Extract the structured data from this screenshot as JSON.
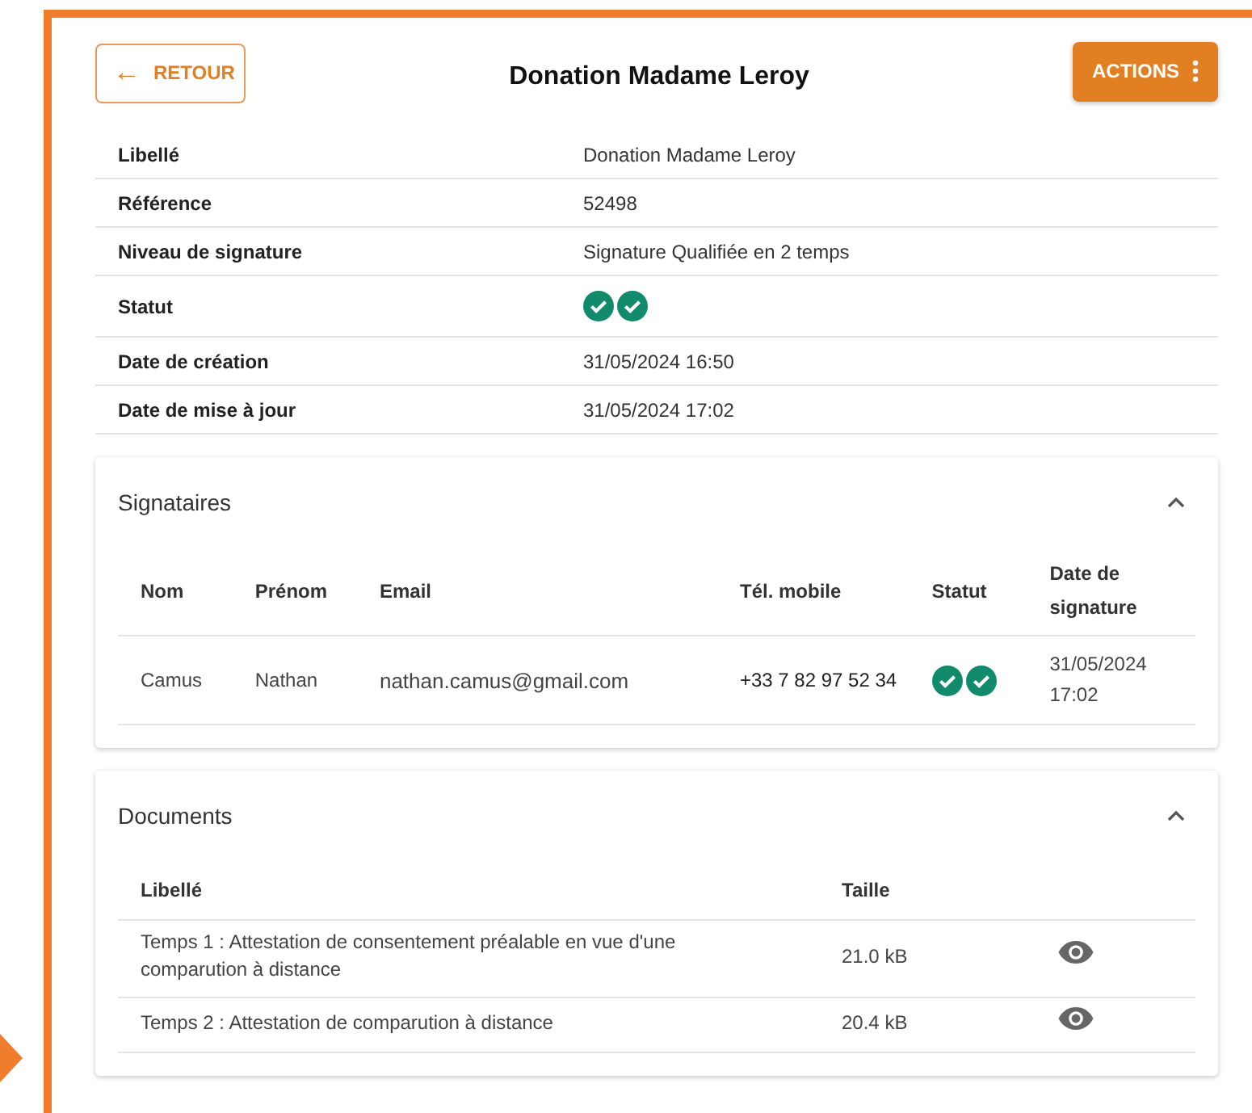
{
  "header": {
    "back_button": {
      "icon": "←",
      "label": "RETOUR"
    },
    "title": "Donation Madame Leroy",
    "actions_button": {
      "label": "ACTIONS"
    }
  },
  "details": [
    {
      "label": "Libellé",
      "kind": "text",
      "value": "Donation Madame Leroy"
    },
    {
      "label": "Référence",
      "kind": "text",
      "value": "52498"
    },
    {
      "label": "Niveau de signature",
      "kind": "text",
      "value": "Signature Qualifiée en 2 temps"
    },
    {
      "label": "Statut",
      "kind": "status",
      "checks": [
        {
          "done": true
        },
        {
          "done": true
        }
      ]
    },
    {
      "label": "Date de création",
      "kind": "text",
      "value": "31/05/2024 16:50"
    },
    {
      "label": "Date de mise à jour",
      "kind": "text",
      "value": "31/05/2024 17:02"
    }
  ],
  "signataires": {
    "title": "Signataires",
    "expanded": true,
    "columns": [
      "Nom",
      "Prénom",
      "Email",
      "Tél. mobile",
      "Statut",
      "Date de signature"
    ],
    "rows": [
      {
        "nom": "Camus",
        "prenom": "Nathan",
        "email": "nathan.camus@gmail.com",
        "phone": "+33 7 82 97 52 34",
        "checks": [
          {
            "done": true
          },
          {
            "done": true
          }
        ],
        "date": "31/05/2024 17:02"
      }
    ]
  },
  "documents": {
    "title": "Documents",
    "expanded": true,
    "columns": [
      "Libellé",
      "Taille"
    ],
    "rows": [
      {
        "name": "Temps 1 : Attestation de consentement préalable en vue d'une comparution à distance",
        "size": "21.0 kB"
      },
      {
        "name": "Temps 2 : Attestation de comparution à distance",
        "size": "20.4 kB"
      }
    ]
  }
}
